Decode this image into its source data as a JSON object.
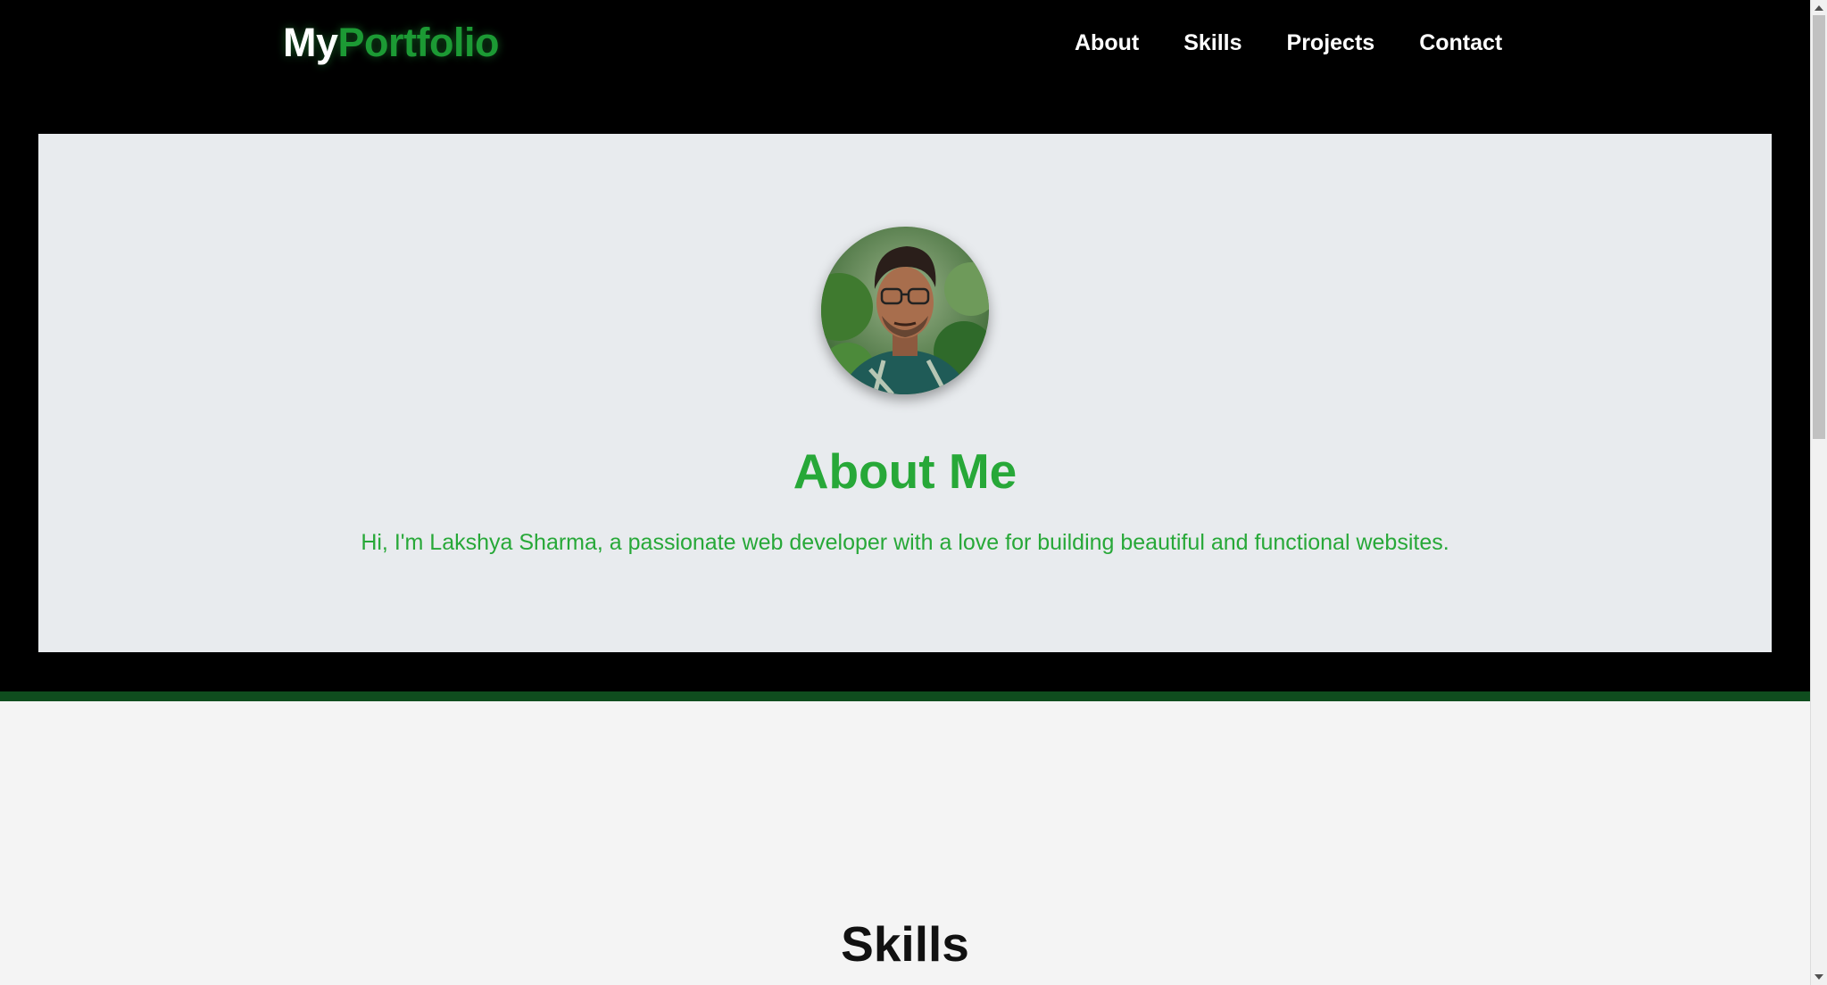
{
  "header": {
    "logo_part1": "My",
    "logo_part2": "Portfolio",
    "nav": [
      "About",
      "Skills",
      "Projects",
      "Contact"
    ]
  },
  "about": {
    "title": "About Me",
    "text": "Hi, I'm Lakshya Sharma, a passionate web developer with a love for building beautiful and functional websites."
  },
  "skills": {
    "title": "Skills"
  },
  "colors": {
    "accent_green": "#27a838",
    "dark_green_line": "#0f4d1e",
    "header_bg": "#000000",
    "card_bg": "#e8ebee"
  }
}
